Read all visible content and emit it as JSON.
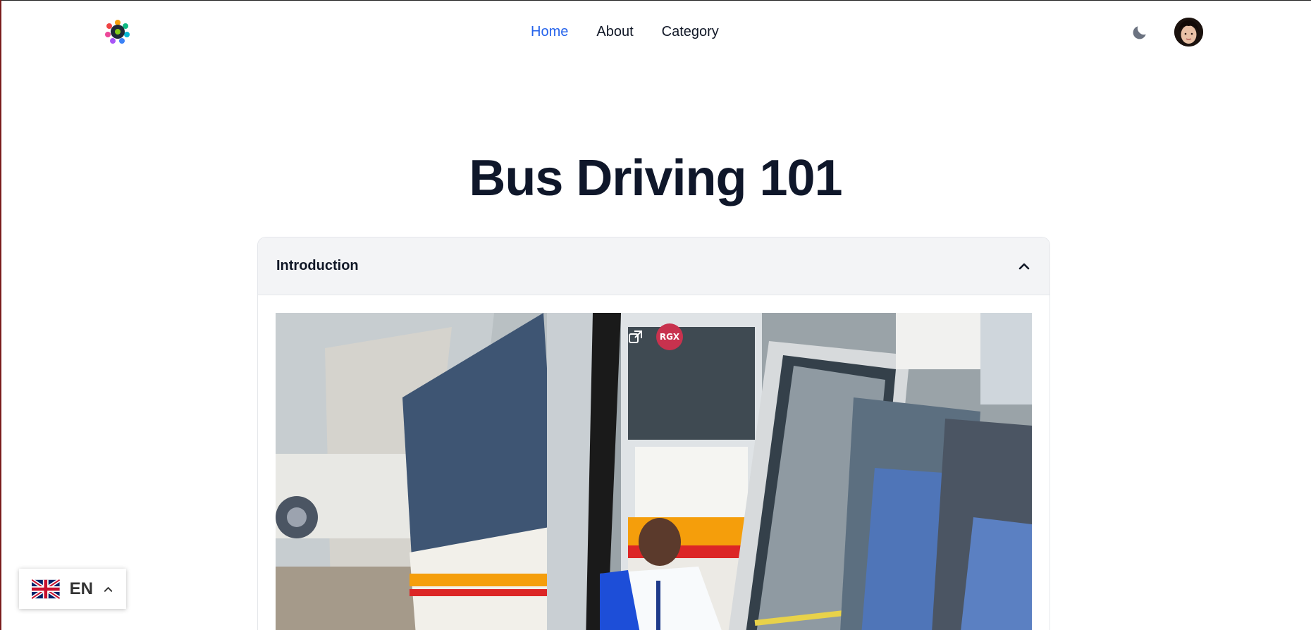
{
  "header": {
    "logo_icon": "colorful-flower-logo-icon",
    "nav": [
      {
        "label": "Home",
        "active": true
      },
      {
        "label": "About",
        "active": false
      },
      {
        "label": "Category",
        "active": false
      }
    ],
    "theme_icon": "moon-icon",
    "avatar_icon": "user-avatar"
  },
  "main": {
    "title": "Bus Driving 101",
    "accordion": {
      "title": "Introduction",
      "expanded": true,
      "toggle_icon": "chevron-up-icon"
    },
    "video_overlay": {
      "badge_label": "RGX",
      "popout_icon": "popout-icon"
    }
  },
  "language": {
    "code": "EN",
    "flag_icon": "uk-flag-icon",
    "toggle_icon": "chevron-up-icon"
  },
  "colors": {
    "accent": "#2563eb",
    "title": "#0f172a",
    "badge": "#c8324e"
  }
}
